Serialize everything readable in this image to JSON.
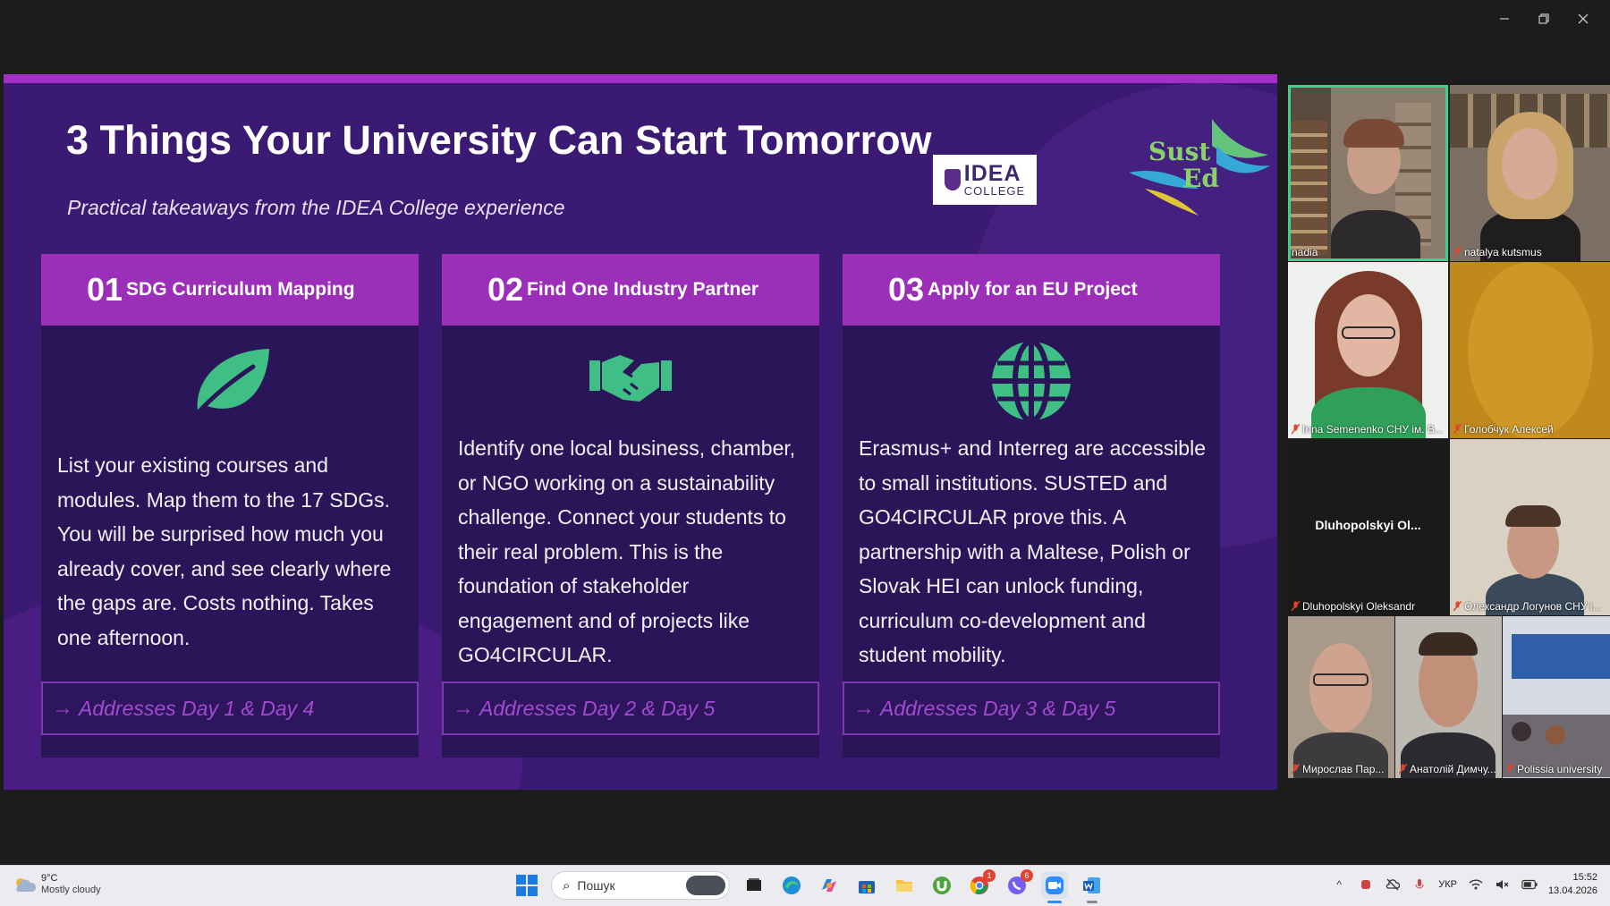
{
  "slide": {
    "title": "3 Things Your University Can Start Tomorrow",
    "subtitle": "Practical takeaways from the IDEA College experience",
    "idea_logo_main": "IDEA",
    "idea_logo_sub": "COLLEGE",
    "sust_logo_line1": "Sust",
    "sust_logo_line2": "Ed",
    "cards": [
      {
        "num": "01",
        "title": "SDG Curriculum Mapping",
        "icon": "leaf-icon",
        "body": "List your existing courses and modules. Map them to the 17 SDGs. You will be surprised how much you already cover, and see clearly where the gaps are. Costs nothing. Takes one afternoon.",
        "footer": "Addresses Day 1 & Day 4"
      },
      {
        "num": "02",
        "title": "Find One Industry Partner",
        "icon": "handshake-icon",
        "body": "Identify one local business, chamber, or NGO working on a sustainability challenge. Connect your students to their real problem. This is the foundation of stakeholder engagement and of projects like GO4CIRCULAR.",
        "footer": "Addresses Day 2 & Day 5"
      },
      {
        "num": "03",
        "title": "Apply for an EU Project",
        "icon": "globe-icon",
        "body": "Erasmus+ and Interreg are accessible to small institutions. SUSTED and GO4CIRCULAR prove this. A partnership with a Maltese, Polish or Slovak HEI can unlock funding, curriculum co-development and student mobility.",
        "footer": "Addresses Day 3 & Day 5"
      }
    ],
    "colors": {
      "background": "#3a1a72",
      "card_header": "#9b2fb8",
      "icon_green": "#3fbf86",
      "footer_text": "#a14bcf"
    }
  },
  "participants": [
    {
      "name": "nadia",
      "muted": false,
      "active": true
    },
    {
      "name": "natalya kutsmus",
      "muted": true,
      "active": false
    },
    {
      "name": "Inna Semenenko СНУ ім. В...",
      "muted": true,
      "active": false
    },
    {
      "name": "Голобчук Алексей",
      "muted": true,
      "active": false
    },
    {
      "name": "Dluhopolskyi Oleksandr",
      "display_name": "Dluhopolskyi Ol...",
      "muted": true,
      "active": false
    },
    {
      "name": "Олександр Логунов СНУ і...",
      "muted": true,
      "active": false
    },
    {
      "name": "Мирослав Пар...",
      "muted": true,
      "active": false
    },
    {
      "name": "Анатолій Димчу...",
      "muted": true,
      "active": false
    },
    {
      "name": "Polissia university",
      "muted": true,
      "active": false
    }
  ],
  "taskbar": {
    "weather_temp": "9°C",
    "weather_desc": "Mostly cloudy",
    "search_placeholder": "Пошук",
    "chrome_badge": "1",
    "viber_badge": "6",
    "language": "УКР",
    "time": "15:52",
    "date": "13.04.2026"
  }
}
